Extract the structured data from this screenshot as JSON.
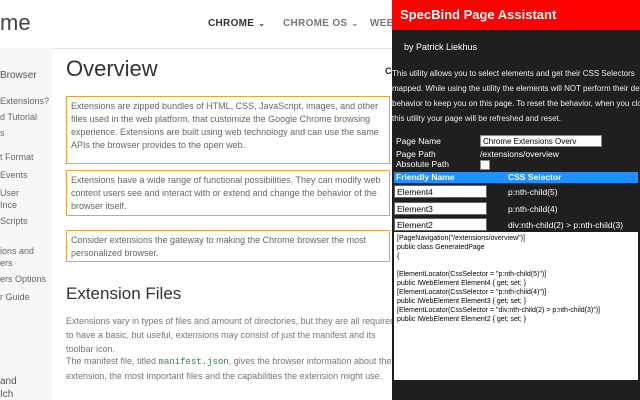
{
  "site": {
    "brand": "me",
    "nav": [
      {
        "label": "CHROME",
        "chev": "⌄"
      },
      {
        "label": "CHROME OS",
        "chev": "⌄"
      },
      {
        "label": "WEB S",
        "chev": ""
      }
    ]
  },
  "sidebar": {
    "header": "Browser",
    "items": [
      "Extensions?",
      "d Tutorial",
      "s",
      "t Format",
      "Events",
      "User",
      "Ince",
      "Scripts",
      "ions and",
      "ers",
      "ers Options",
      "r Guide"
    ],
    "bottom": [
      "and",
      "Ich"
    ]
  },
  "main": {
    "title": "Overview",
    "box1": "Extensions are zipped bundles of HTML, CSS, JavaScript, images, and other files used in the web platform, that customize the Google Chrome browsing experience. Extensions are built using web technology and can use the same APIs the browser provides to the open web.",
    "box2": "Extensions have a wide range of functional possibilities. They can modify web content users see and interact with or extend and change the behavior of the browser itself.",
    "box3": "Consider extensions the gateway to making the Chrome browser the most personalized browser.",
    "section": "Extension Files",
    "para1": "Extensions vary in types of files and amount of directories, but they are all required to have a basic, but useful, extensions may consist of just the manifest and its toolbar icon.",
    "para2_pre": "The manifest file, titled ",
    "para2_code": "manifest.json",
    "para2_post": ", gives the browser information about the extension, the most important files and the capabilities the extension might use.",
    "cut_label": "Co"
  },
  "panel": {
    "title": "SpecBind Page Assistant",
    "author": "by Patrick Liekhus",
    "desc": [
      "This utility allows you to select elements and get their CSS Selectors",
      "mapped. While using the utility the elements will NOT perform their default",
      "behavior to keep you on this page. To reset the behavior, when you close",
      "this utility your page will be refreshed and reset."
    ],
    "page_name_label": "Page Name",
    "page_name_value": "Chrome Extensions Overv",
    "page_path_label": "Page Path",
    "page_path_value": "/extensions/overview",
    "absolute_path_label": "Absolute Path",
    "table_header": {
      "friendly": "Friendly Name",
      "selector": "CSS Selector"
    },
    "rows": [
      {
        "name": "Element4",
        "selector": "p:nth-child(5)"
      },
      {
        "name": "Element3",
        "selector": "p:nth-child(4)"
      },
      {
        "name": "Element2",
        "selector": "div:nth-child(2) > p:nth-child(3)"
      }
    ],
    "code": [
      "[PageNavigation(\"/extensions/overview\")]",
      "public class GeneratedPage",
      "{",
      "[ElementLocator(CssSelector = \"p:nth-child(5)\")]",
      "public IWebElement Element4 { get; set; }",
      "",
      "[ElementLocator(CssSelector = \"p:nth-child(4)\")]",
      "public IWebElement Element3 { get; set; }",
      "",
      "[ElementLocator(CssSelector = \"div:nth-child(2) > p:nth-child(3)\")]",
      "public IWebElement Element2 { get; set; }"
    ]
  },
  "colors": {
    "accent_red": "#ff0000",
    "table_header_blue": "#1e90ff",
    "highlight_orange": "#e8a33d",
    "panel_bg": "#1f1f1f"
  }
}
